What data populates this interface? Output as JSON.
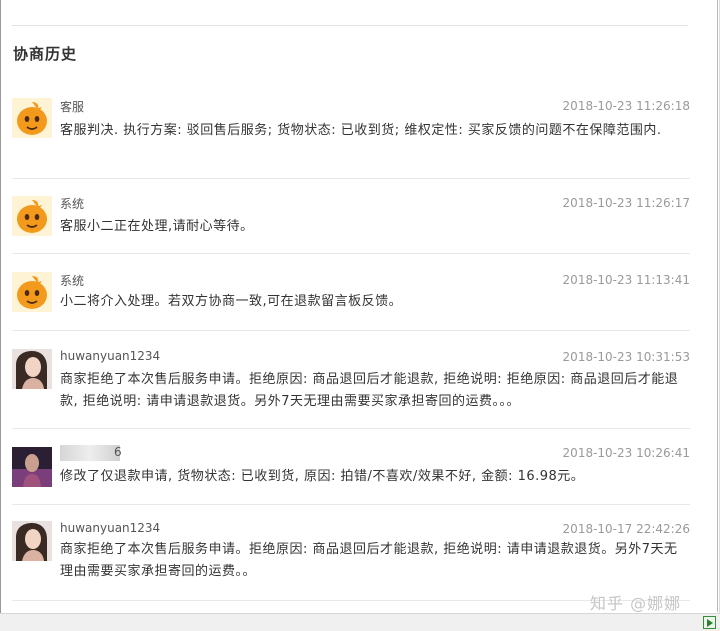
{
  "section_title": "协商历史",
  "entries": [
    {
      "avatar": "mascot-avatar",
      "name": "客服",
      "time": "2018-10-23 11:26:18",
      "message": "客服判决. 执行方案: 驳回售后服务; 货物状态: 已收到货; 维权定性: 买家反馈的问题不在保障范围内."
    },
    {
      "avatar": "mascot-avatar",
      "name": "系统",
      "time": "2018-10-23 11:26:17",
      "message": "客服小二正在处理,请耐心等待。"
    },
    {
      "avatar": "mascot-avatar",
      "name": "系统",
      "time": "2018-10-23 11:13:41",
      "message": "小二将介入处理。若双方协商一致,可在退款留言板反馈。"
    },
    {
      "avatar": "seller-photo-avatar",
      "name": "huwanyuan1234",
      "time": "2018-10-23 10:31:53",
      "message": "商家拒绝了本次售后服务申请。拒绝原因: 商品退回后才能退款, 拒绝说明: 拒绝原因: 商品退回后才能退款, 拒绝说明: 请申请退款退货。另外7天无理由需要买家承担寄回的运费。。。"
    },
    {
      "avatar": "buyer-photo-avatar",
      "name": "6",
      "time": "2018-10-23 10:26:41",
      "message": "修改了仅退款申请, 货物状态: 已收到货, 原因: 拍错/不喜欢/效果不好, 金额: 16.98元。"
    },
    {
      "avatar": "seller-photo-avatar",
      "name": "huwanyuan1234",
      "time": "2018-10-17 22:42:26",
      "message": "商家拒绝了本次售后服务申请。拒绝原因: 商品退回后才能退款, 拒绝说明: 请申请退款退货。另外7天无理由需要买家承担寄回的运费。。"
    }
  ],
  "watermark": "知乎 @娜娜",
  "colors": {
    "mascot_orange": "#f39a1d",
    "text": "#333333",
    "timestamp": "#9a9a9a",
    "divider": "#e8e8e8"
  }
}
